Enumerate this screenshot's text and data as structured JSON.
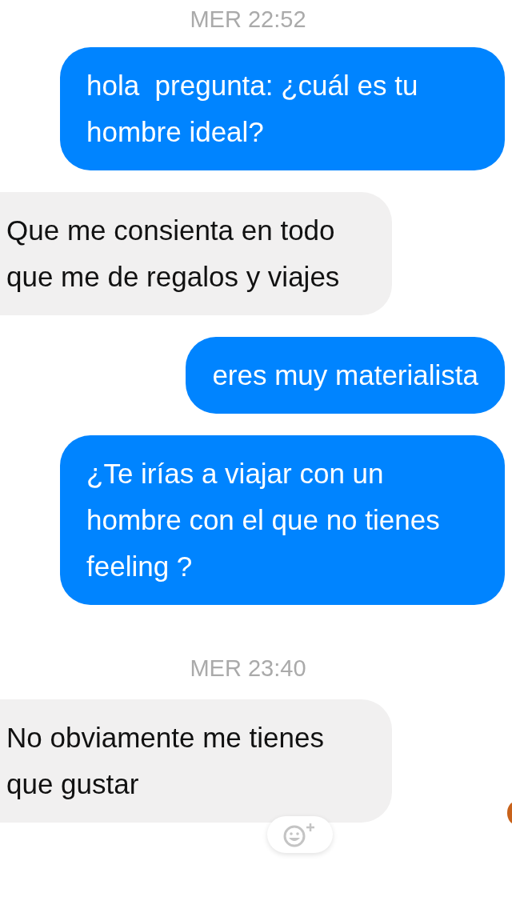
{
  "thread": [
    {
      "kind": "timestamp",
      "text": "MER 22:52"
    },
    {
      "kind": "outgoing",
      "text": "hola  pregunta: ¿cuál es tu hombre ideal?"
    },
    {
      "kind": "incoming",
      "text": "Que me consienta en todo que me de regalos y viajes"
    },
    {
      "kind": "outgoing",
      "text": "eres muy materialista"
    },
    {
      "kind": "outgoing",
      "text": "¿Te irías a viajar con un hombre con el que no tienes feeling ?"
    },
    {
      "kind": "timestamp",
      "text": "MER 23:40"
    },
    {
      "kind": "incoming",
      "text": "No obviamente me tienes que gustar",
      "reaction_button": true
    }
  ]
}
